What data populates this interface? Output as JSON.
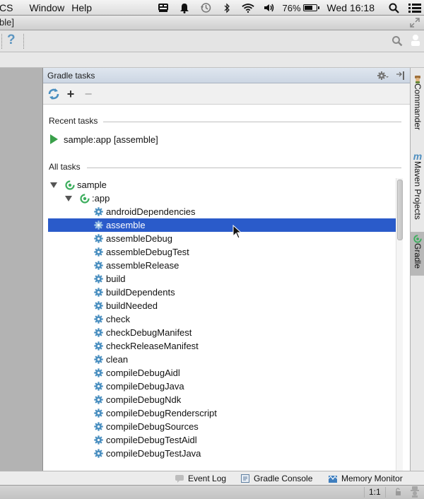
{
  "menubar": {
    "items": [
      "CS",
      "Window",
      "Help"
    ],
    "status_icons": [
      "screen-sharing-icon",
      "notification-bell-icon",
      "time-machine-icon",
      "bluetooth-icon",
      "wifi-icon",
      "volume-icon"
    ],
    "battery_percent_label": "76%",
    "battery_level": 0.76,
    "clock": "Wed 16:18"
  },
  "window": {
    "title_fragment": "ble]"
  },
  "toolbar": {
    "help_label": "?"
  },
  "gradle_panel": {
    "title": "Gradle tasks",
    "recent_tasks_label": "Recent tasks",
    "recent_tasks": [
      "sample:app [assemble]"
    ],
    "all_tasks_label": "All tasks",
    "tree": {
      "root": "sample",
      "module": ":app",
      "selected_task": "assemble",
      "tasks": [
        "androidDependencies",
        "assemble",
        "assembleDebug",
        "assembleDebugTest",
        "assembleRelease",
        "build",
        "buildDependents",
        "buildNeeded",
        "check",
        "checkDebugManifest",
        "checkReleaseManifest",
        "clean",
        "compileDebugAidl",
        "compileDebugJava",
        "compileDebugNdk",
        "compileDebugRenderscript",
        "compileDebugSources",
        "compileDebugTestAidl",
        "compileDebugTestJava"
      ]
    }
  },
  "right_strip": {
    "tabs": [
      {
        "label": "Commander",
        "active": false
      },
      {
        "label": "Maven Projects",
        "active": false
      },
      {
        "label": "Gradle",
        "active": true
      }
    ]
  },
  "bottom_bar": {
    "event_log": "Event Log",
    "gradle_console": "Gradle Console",
    "memory_monitor": "Memory Monitor"
  },
  "status_bar": {
    "caret_position": "1:1"
  },
  "colors": {
    "selection": "#2a5bca",
    "run_green": "#3aa04a",
    "gear_blue": "#4a8fc0",
    "gradle_green": "#3dae5e"
  }
}
